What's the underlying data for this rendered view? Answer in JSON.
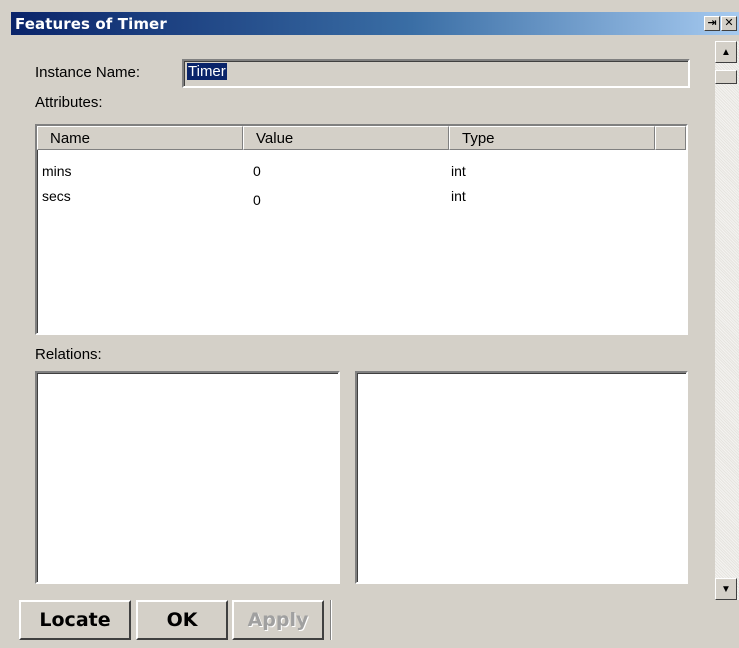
{
  "window": {
    "title": "Features of Timer",
    "pin_glyph": "⇥",
    "close_glyph": "✕"
  },
  "instance": {
    "label": "Instance Name:",
    "value": "Timer"
  },
  "attributes": {
    "label": "Attributes:",
    "columns": [
      "Name",
      "Value",
      "Type"
    ],
    "rows": [
      {
        "name": "mins",
        "value": "0",
        "type": "int"
      },
      {
        "name": "secs",
        "value": "0",
        "type": "int"
      }
    ]
  },
  "relations": {
    "label": "Relations:"
  },
  "buttons": {
    "locate": "Locate",
    "ok": "OK",
    "apply": "Apply"
  },
  "scrollbar": {
    "up_glyph": "▲",
    "down_glyph": "▼"
  }
}
